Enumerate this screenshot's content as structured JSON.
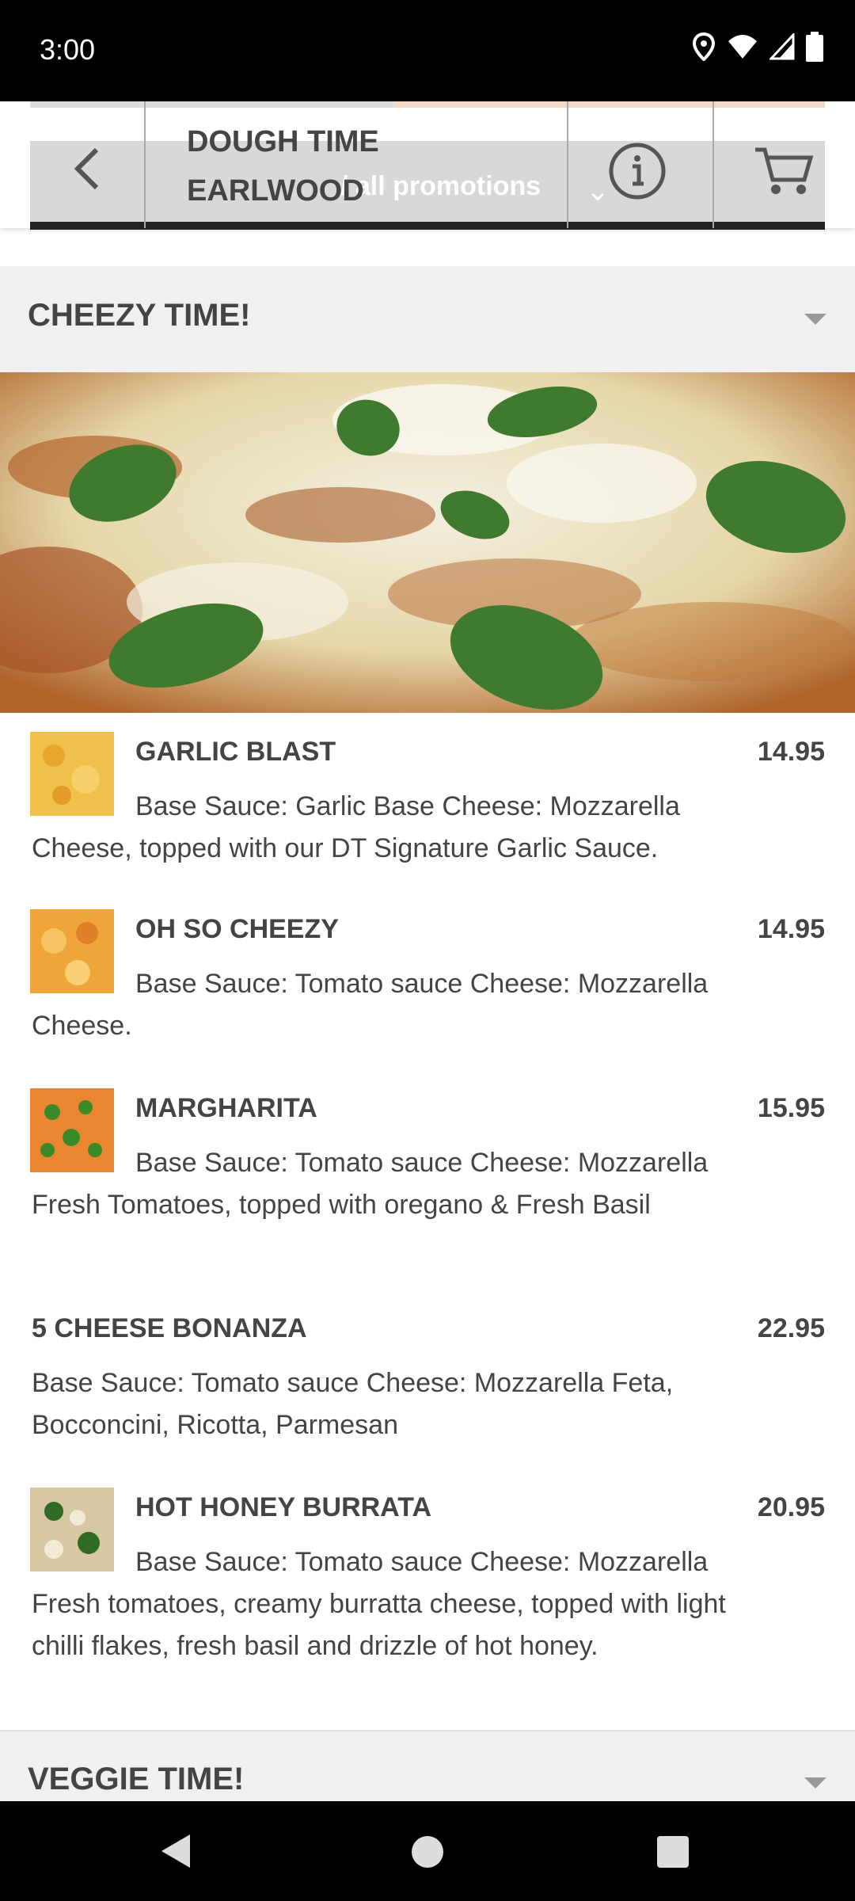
{
  "status_bar": {
    "time": "3:00"
  },
  "header": {
    "store_name_line1": "DOUGH TIME",
    "store_name_line2": "EARLWOOD",
    "promotions_label": "/ all promotions"
  },
  "categories": [
    {
      "title": "CHEEZY TIME!"
    },
    {
      "title": "VEGGIE TIME!"
    }
  ],
  "items": [
    {
      "name": "GARLIC BLAST",
      "price": "14.95",
      "description": "Base Sauce: Garlic Base Cheese: Mozzarella Cheese, topped with our DT Signature Garlic Sauce."
    },
    {
      "name": "OH SO CHEEZY",
      "price": "14.95",
      "description": "Base Sauce: Tomato sauce Cheese: Mozzarella Cheese."
    },
    {
      "name": "MARGHARITA",
      "price": "15.95",
      "description": "Base Sauce: Tomato sauce Cheese: Mozzarella Fresh Tomatoes, topped with oregano & Fresh Basil"
    },
    {
      "name": "5 CHEESE BONANZA",
      "price": "22.95",
      "description": "Base Sauce: Tomato sauce Cheese: Mozzarella Feta, Bocconcini, Ricotta, Parmesan"
    },
    {
      "name": "HOT HONEY BURRATA",
      "price": "20.95",
      "description": "Base Sauce: Tomato sauce Cheese: Mozzarella Fresh tomatoes, creamy burratta cheese, topped with light chilli flakes, fresh basil and drizzle of hot honey."
    }
  ],
  "icons": {
    "back": "chevron-left-icon",
    "info": "info-icon",
    "cart": "cart-icon",
    "dropdown": "caret-down-icon"
  }
}
